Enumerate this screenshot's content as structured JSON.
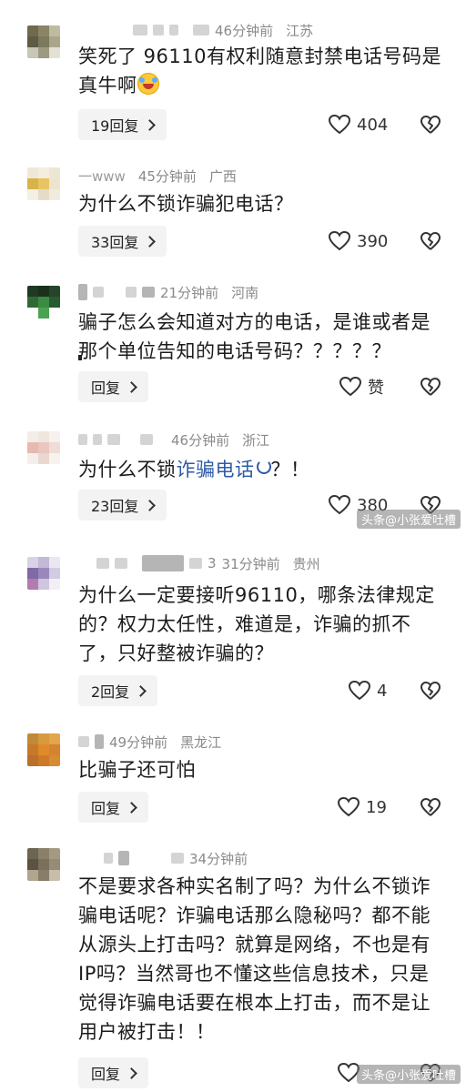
{
  "comments": [
    {
      "time": "46分钟前",
      "location": "江苏",
      "text": "笑死了 96110有权利随意封禁电话号码是真牛啊",
      "reply": "19回复",
      "likes": "404"
    },
    {
      "name": "一www",
      "time": "45分钟前",
      "location": "广西",
      "text": "为什么不锁诈骗犯电话？",
      "reply": "33回复",
      "likes": "390"
    },
    {
      "time": "21分钟前",
      "location": "河南",
      "text": "骗子怎么会知道对方的电话，是谁或者是那个单位告知的电话号码？？？？？",
      "reply": "回复",
      "likes": "赞"
    },
    {
      "time": "46分钟前",
      "location": "浙江",
      "text_before": "为什么不锁",
      "text_link": "诈骗电话",
      "text_after": "？！",
      "reply": "23回复",
      "likes": "380"
    },
    {
      "name_suffix": "3",
      "time": "31分钟前",
      "location": "贵州",
      "text": "为什么一定要接听96110，哪条法律规定的？权力太任性，难道是，诈骗的抓不了，只好整被诈骗的？",
      "reply": "2回复",
      "likes": "4"
    },
    {
      "time": "49分钟前",
      "location": "黑龙江",
      "text": "比骗子还可怕",
      "reply": "回复",
      "likes": "19"
    },
    {
      "time": "34分钟前",
      "text": "不是要求各种实名制了吗？为什么不锁诈骗电话呢？诈骗电话那么隐秘吗？都不能从源头上打击吗？就算是网络，不也是有IP吗？当然哥也不懂这些信息技术，只是觉得诈骗电话要在根本上打击，而不是让用户被打击！！",
      "reply": "回复",
      "likes": ""
    }
  ],
  "watermark": "头条@小张爱吐槽",
  "icons": {
    "like": "heart-outline-icon",
    "dislike": "broken-heart-icon",
    "reply_arrow": "chevron-right-icon"
  }
}
